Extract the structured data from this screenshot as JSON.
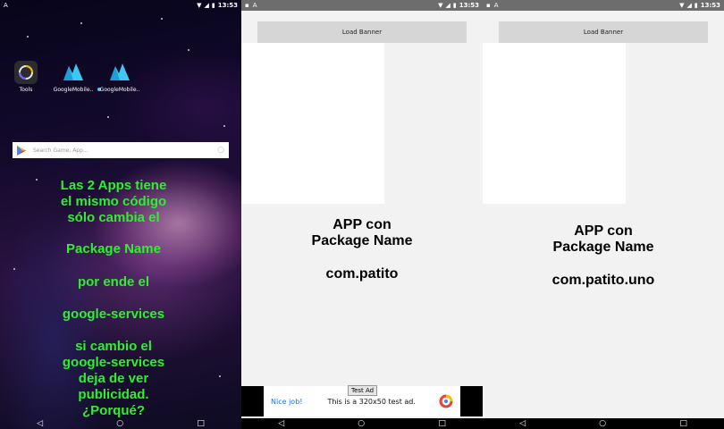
{
  "status_bar": {
    "time": "13:53",
    "left_glyph": "A",
    "icons": [
      "wifi-icon",
      "signal-icon",
      "battery-icon"
    ]
  },
  "nav_bar": {
    "back": "◁",
    "home": "○",
    "recents": "□"
  },
  "launcher": {
    "apps": [
      {
        "label": "Tools",
        "icon": "tools-icon"
      },
      {
        "label": "GoogleMobile..",
        "icon": "googlemobile-icon"
      },
      {
        "label": "GoogleMobile..",
        "icon": "googlemobile-icon"
      }
    ],
    "search_placeholder": "Search Game, App...",
    "message_lines": [
      "Las 2 Apps tiene",
      "el mismo código",
      "sólo cambia el",
      "Package Name",
      "por ende el",
      "google-services",
      "si cambio el",
      "google-services",
      "deja de ver",
      "publicidad.",
      "¿Porqué?"
    ],
    "colors": {
      "message": "#2bf22b"
    }
  },
  "app1": {
    "load_banner_label": "Load Banner",
    "info_line1": "APP con",
    "info_line2": "Package Name",
    "package": "com.patito",
    "ad": {
      "tag": "Test Ad",
      "nice": "Nice job!",
      "text": "This is a 320x50 test ad."
    }
  },
  "app2": {
    "load_banner_label": "Load Banner",
    "info_line1": "APP con",
    "info_line2": "Package Name",
    "package": "com.patito.uno"
  },
  "colors": {
    "app_bg": "#f2f2f2",
    "button_bg": "#d6d6d6",
    "status_bar": "#6d6d6d"
  }
}
